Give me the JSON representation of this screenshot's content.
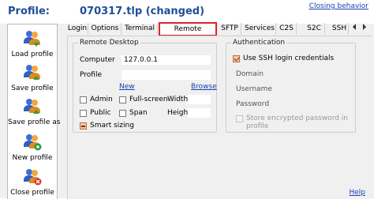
{
  "header": {
    "profile_heading": "Profile:",
    "profile_name": "070317.tlp (changed)",
    "closing_behavior": "Closing behavior"
  },
  "sidebar": {
    "items": [
      {
        "label": "Load profile",
        "icon": "load-profile-icon"
      },
      {
        "label": "Save profile",
        "icon": "save-profile-icon"
      },
      {
        "label": "Save profile as",
        "icon": "save-profile-as-icon"
      },
      {
        "label": "New profile",
        "icon": "new-profile-icon"
      },
      {
        "label": "Close profile",
        "icon": "close-profile-icon"
      }
    ]
  },
  "tabs": [
    {
      "label": "Login"
    },
    {
      "label": "Options"
    },
    {
      "label": "Terminal"
    },
    {
      "label": "Remote Desktop",
      "active": true
    },
    {
      "label": "SFTP"
    },
    {
      "label": "Services"
    },
    {
      "label": "C2S"
    },
    {
      "label": "S2C"
    },
    {
      "label": "SSH"
    }
  ],
  "remote_desktop": {
    "group_title": "Remote Desktop",
    "computer_label": "Computer",
    "computer_value": "127.0.0.1",
    "profile_label": "Profile",
    "profile_value": "",
    "new_link": "New",
    "browse_link": "Browse",
    "admin_label": "Admin",
    "admin_checked": false,
    "fullscreen_label": "Full-screen",
    "fullscreen_checked": false,
    "width_label": "Width",
    "width_value": "",
    "public_label": "Public",
    "public_checked": false,
    "span_label": "Span",
    "span_checked": false,
    "height_label": "Height",
    "height_value": "",
    "smart_sizing_label": "Smart sizing",
    "smart_sizing_state": "indeterminate"
  },
  "authentication": {
    "group_title": "Authentication",
    "use_ssh_label": "Use SSH login credentials",
    "use_ssh_checked": true,
    "domain_label": "Domain",
    "username_label": "Username",
    "password_label": "Password",
    "store_encrypted_label": "Store encrypted password in profile",
    "store_encrypted_checked": false,
    "store_encrypted_enabled": false
  },
  "footer": {
    "help_link": "Help"
  },
  "colors": {
    "accent_blue": "#1f4e99",
    "active_tab_border": "#d9252e",
    "link_blue": "#1a3fb0"
  }
}
